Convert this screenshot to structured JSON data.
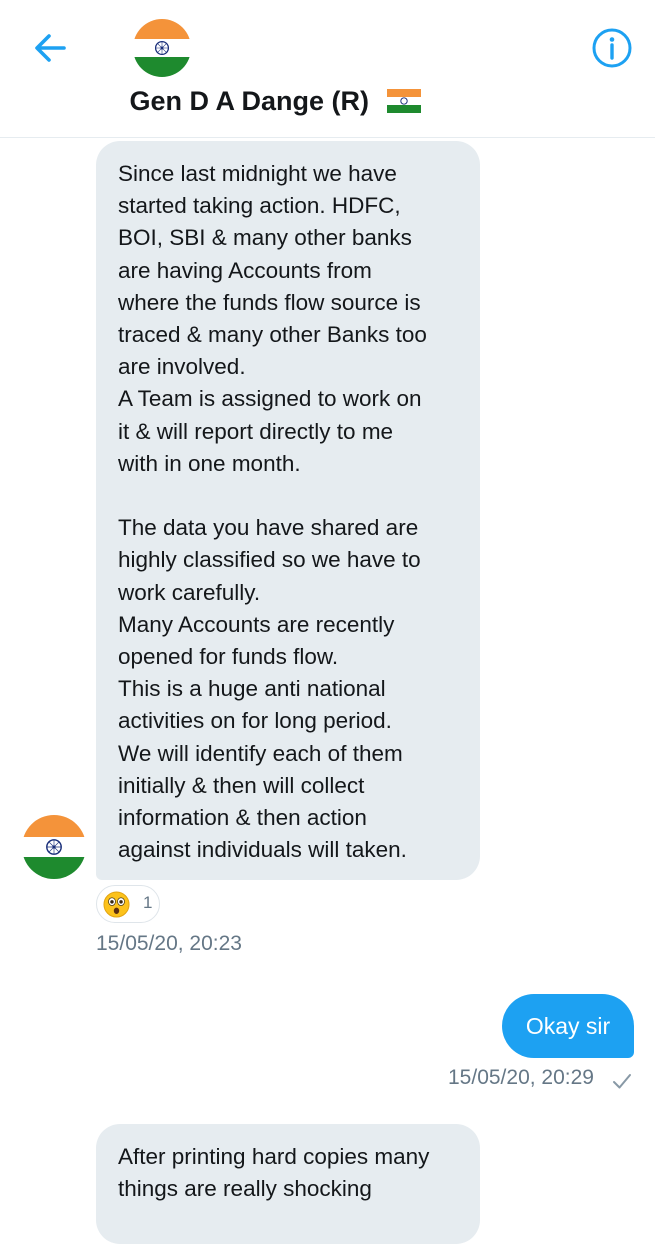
{
  "header": {
    "title": "Gen D A Dange (R)",
    "back_icon": "arrow-left-icon",
    "info_icon": "info-icon",
    "avatar": "india-flag-avatar",
    "accent_color": "#1da1f2"
  },
  "messages": [
    {
      "direction": "incoming",
      "text": "Since last midnight we have\nstarted taking action. HDFC,\nBOI, SBI & many other banks\nare having Accounts from\nwhere the funds flow source is\ntraced & many other Banks too\nare involved.\nA Team is assigned to work on\nit & will report directly to me\nwith in one month.\n\nThe data you have shared are\nhighly classified so we have to\nwork carefully.\nMany Accounts are recently\nopened for funds flow.\nThis is a huge anti national\nactivities on for long period.\nWe will identify each of them\ninitially & then will collect\ninformation & then action\nagainst individuals will taken.",
      "reaction": {
        "emoji": "astonished-face-emoji",
        "count": "1"
      },
      "timestamp": "15/05/20, 20:23"
    },
    {
      "direction": "outgoing",
      "text": "Okay sir",
      "timestamp": "15/05/20, 20:29",
      "status_icon": "sent-check-icon"
    },
    {
      "direction": "incoming",
      "text": "After printing hard copies many\nthings are really shocking"
    }
  ],
  "colors": {
    "incoming_bubble": "#e6ecf0",
    "outgoing_bubble": "#1da1f2",
    "timestamp_text": "#657786"
  }
}
